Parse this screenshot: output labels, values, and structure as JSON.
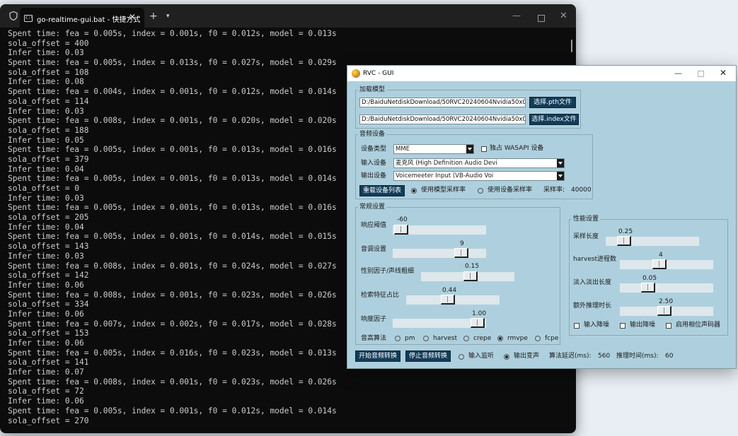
{
  "terminal": {
    "tab_title": "go-realtime-gui.bat - 快捷方式",
    "tab_icon": "cmd-icon",
    "lines": [
      "Spent time: fea = 0.005s, index = 0.001s, f0 = 0.012s, model = 0.013s",
      "sola_offset = 400",
      "Infer time: 0.03",
      "Spent time: fea = 0.005s, index = 0.013s, f0 = 0.027s, model = 0.029s",
      "sola_offset = 108",
      "Infer time: 0.08",
      "Spent time: fea = 0.004s, index = 0.001s, f0 = 0.012s, model = 0.014s",
      "sola_offset = 114",
      "Infer time: 0.03",
      "Spent time: fea = 0.008s, index = 0.001s, f0 = 0.020s, model = 0.020s",
      "sola_offset = 188",
      "Infer time: 0.05",
      "Spent time: fea = 0.005s, index = 0.001s, f0 = 0.013s, model = 0.016s",
      "sola_offset = 379",
      "Infer time: 0.04",
      "Spent time: fea = 0.005s, index = 0.001s, f0 = 0.013s, model = 0.014s",
      "sola_offset = 0",
      "Infer time: 0.03",
      "Spent time: fea = 0.005s, index = 0.001s, f0 = 0.013s, model = 0.016s",
      "sola_offset = 205",
      "Infer time: 0.04",
      "Spent time: fea = 0.005s, index = 0.001s, f0 = 0.014s, model = 0.015s",
      "sola_offset = 143",
      "Infer time: 0.03",
      "Spent time: fea = 0.008s, index = 0.001s, f0 = 0.024s, model = 0.027s",
      "sola_offset = 142",
      "Infer time: 0.06",
      "Spent time: fea = 0.008s, index = 0.001s, f0 = 0.023s, model = 0.026s",
      "sola_offset = 334",
      "Infer time: 0.06",
      "Spent time: fea = 0.007s, index = 0.002s, f0 = 0.017s, model = 0.028s",
      "sola_offset = 153",
      "Infer time: 0.06",
      "Spent time: fea = 0.005s, index = 0.016s, f0 = 0.023s, model = 0.013s",
      "sola_offset = 141",
      "Infer time: 0.07",
      "Spent time: fea = 0.008s, index = 0.001s, f0 = 0.023s, model = 0.026s",
      "sola_offset = 72",
      "Infer time: 0.06",
      "Spent time: fea = 0.005s, index = 0.001s, f0 = 0.012s, model = 0.014s",
      "sola_offset = 270"
    ]
  },
  "gui": {
    "title": "RVC - GUI",
    "load_model": {
      "title": "加载模型",
      "pth_path": "D:/BaiduNetdiskDownload/50RVC20240604Nvidia50x0/",
      "pth_button": "选择.pth文件",
      "index_path": "D:/BaiduNetdiskDownload/50RVC20240604Nvidia50x0/",
      "index_button": "选择.index文件"
    },
    "audio_device": {
      "title": "音频设备",
      "type_label": "设备类型",
      "type_value": "MME",
      "wasapi_label": "独占 WASAPI 设备",
      "input_label": "输入设备",
      "input_value": "麦克风 (High Definition Audio Devi",
      "output_label": "输出设备",
      "output_value": "Voicemeeter Input (VB-Audio Voi",
      "reload_button": "重载设备列表",
      "use_model_sr": "使用模型采样率",
      "use_device_sr": "使用设备采样率",
      "sr_label": "采样率:",
      "sr_value": "40000"
    },
    "general": {
      "title": "常规设置",
      "sliders": [
        {
          "label": "响应阈值",
          "value": "-60"
        },
        {
          "label": "音调设置",
          "value": "9"
        },
        {
          "label": "性别因子/声线粗细",
          "value": "0.15"
        },
        {
          "label": "检索特征占比",
          "value": "0.44"
        },
        {
          "label": "响度因子",
          "value": "1.00"
        }
      ],
      "pitch_algo_label": "音高算法",
      "algos": [
        "pm",
        "harvest",
        "crepe",
        "rmvpe",
        "fcpe"
      ],
      "selected_algo": "rmvpe"
    },
    "performance": {
      "title": "性能设置",
      "sliders": [
        {
          "label": "采样长度",
          "value": "0.25"
        },
        {
          "label": "harvest进程数",
          "value": "4"
        },
        {
          "label": "淡入淡出长度",
          "value": "0.05"
        },
        {
          "label": "额外推理时长",
          "value": "2.50"
        }
      ],
      "checks": [
        "输入降噪",
        "输出降噪",
        "启用相位声码器"
      ]
    },
    "bottom": {
      "start_button": "开始音频转换",
      "stop_button": "停止音频转换",
      "input_monitor": "输入监听",
      "output_voice": "输出变声",
      "delay_label": "算法延迟(ms):",
      "delay_value": "560",
      "infer_label": "推理时间(ms):",
      "infer_value": "60"
    }
  }
}
